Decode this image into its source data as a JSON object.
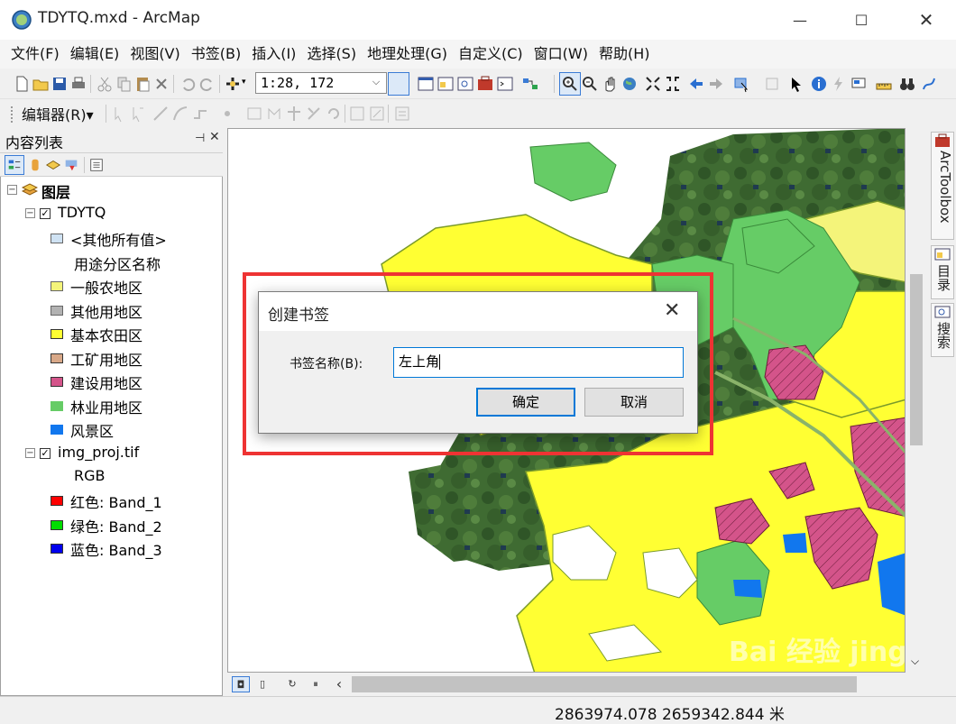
{
  "window": {
    "title": "TDYTQ.mxd - ArcMap"
  },
  "menu": [
    "文件(F)",
    "编辑(E)",
    "视图(V)",
    "书签(B)",
    "插入(I)",
    "选择(S)",
    "地理处理(G)",
    "自定义(C)",
    "窗口(W)",
    "帮助(H)"
  ],
  "toolbar": {
    "scale": "1:28, 172",
    "editor_label": "编辑器(R)▾"
  },
  "toc": {
    "title": "内容列表",
    "root": "图层",
    "layers": [
      {
        "name": "TDYTQ",
        "field": "用途分区名称",
        "other_label": "<其他所有值>",
        "classes": [
          {
            "label": "一般农地区",
            "color": "#f4f47a"
          },
          {
            "label": "其他用地区",
            "color": "#b2b2b2"
          },
          {
            "label": "基本农田区",
            "color": "#ffff33"
          },
          {
            "label": "工矿用地区",
            "color": "#d8a888"
          },
          {
            "label": "建设用地区",
            "color": "#d4548a"
          },
          {
            "label": "林业用地区",
            "color": "#66cc66"
          },
          {
            "label": "风景区",
            "color": "#1177ee"
          }
        ]
      },
      {
        "name": "img_proj.tif",
        "render": "RGB",
        "bands": [
          {
            "label": "红色:   Band_1",
            "color": "#ff0000"
          },
          {
            "label": "绿色: Band_2",
            "color": "#00dd00"
          },
          {
            "label": "蓝色:   Band_3",
            "color": "#0000ee"
          }
        ]
      }
    ]
  },
  "dock": {
    "arctoolbox": "ArcToolbox",
    "catalog": "目录",
    "search": "搜索"
  },
  "dialog": {
    "title": "创建书签",
    "label": "书签名称(B):",
    "value": "左上角",
    "ok": "确定",
    "cancel": "取消"
  },
  "status": {
    "coords": "2863974.078  2659342.844 米"
  },
  "watermark": "Bai 经验 jingyan.baidu.com"
}
